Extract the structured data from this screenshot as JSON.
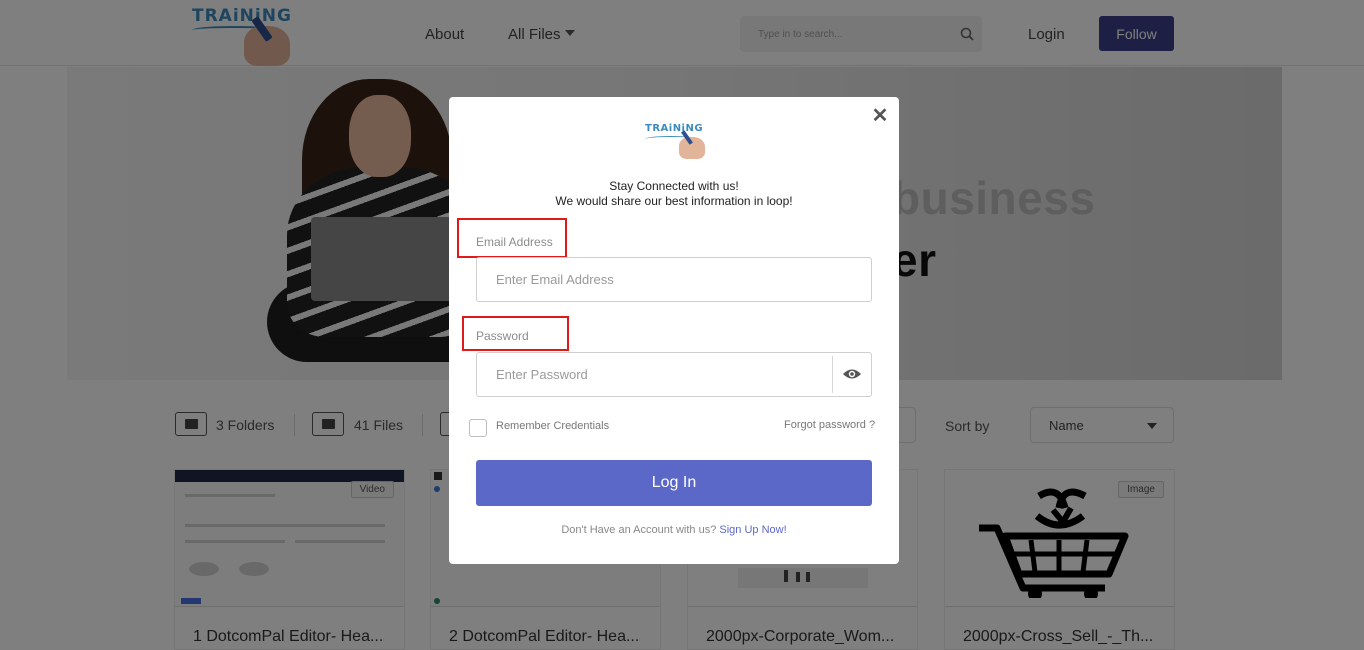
{
  "header": {
    "logo_text": "TRAiNiNG",
    "nav": {
      "about": "About",
      "all_files": "All Files"
    },
    "search_placeholder": "Type in to search...",
    "login": "Login",
    "follow": "Follow"
  },
  "hero": {
    "headline_line1": "business",
    "headline_line2": "er"
  },
  "toolbar": {
    "folders_label": "3 Folders",
    "files_label": "41 Files",
    "sort_label": "Sort by",
    "sort_value": "Name"
  },
  "cards": [
    {
      "title": "1 DotcomPal Editor- Hea...",
      "badge": "Video"
    },
    {
      "title": "2 DotcomPal Editor- Hea...",
      "badge": ""
    },
    {
      "title": "2000px-Corporate_Wom...",
      "badge": ""
    },
    {
      "title": "2000px-Cross_Sell_-_Th...",
      "badge": "Image"
    }
  ],
  "modal": {
    "logo_text": "TRAiNiNG",
    "tagline_line1": "Stay Connected with us!",
    "tagline_line2": "We would share our best information in loop!",
    "email_label": "Email Address",
    "email_placeholder": "Enter Email Address",
    "password_label": "Password",
    "password_placeholder": "Enter Password",
    "remember_label": "Remember Credentials",
    "forgot_link": "Forgot password ?",
    "login_button": "Log In",
    "signup_prompt": "Don't Have an Account with us?",
    "signup_link": "Sign Up Now!",
    "close_icon": "close-icon"
  },
  "colors": {
    "primary_button": "#5c68c8",
    "follow_button": "#3a3f8a",
    "highlight": "#e01919",
    "logo_blue": "#3c8bbf"
  }
}
